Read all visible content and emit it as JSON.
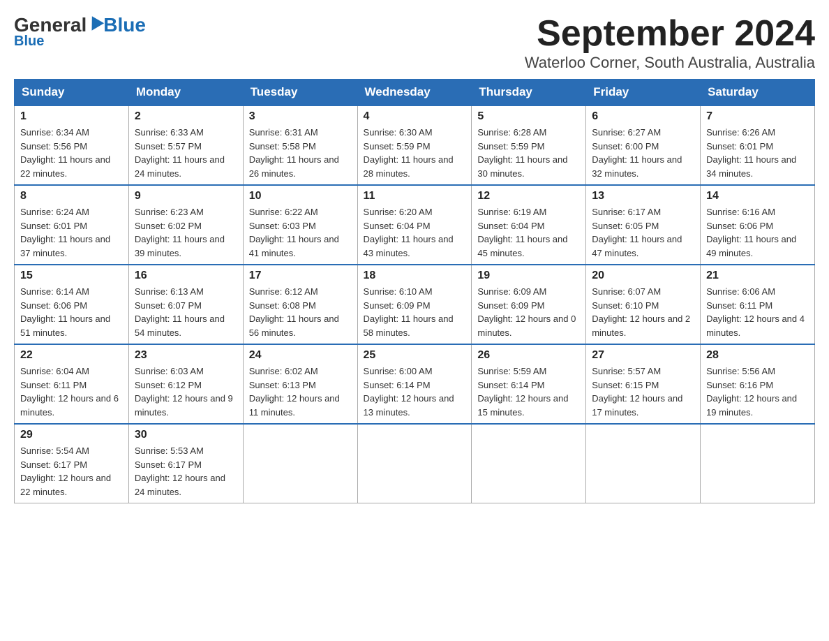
{
  "header": {
    "logo_general": "General",
    "logo_blue": "Blue",
    "month_title": "September 2024",
    "location": "Waterloo Corner, South Australia, Australia"
  },
  "weekdays": [
    "Sunday",
    "Monday",
    "Tuesday",
    "Wednesday",
    "Thursday",
    "Friday",
    "Saturday"
  ],
  "weeks": [
    [
      {
        "day": "1",
        "sunrise": "6:34 AM",
        "sunset": "5:56 PM",
        "daylight": "11 hours and 22 minutes."
      },
      {
        "day": "2",
        "sunrise": "6:33 AM",
        "sunset": "5:57 PM",
        "daylight": "11 hours and 24 minutes."
      },
      {
        "day": "3",
        "sunrise": "6:31 AM",
        "sunset": "5:58 PM",
        "daylight": "11 hours and 26 minutes."
      },
      {
        "day": "4",
        "sunrise": "6:30 AM",
        "sunset": "5:59 PM",
        "daylight": "11 hours and 28 minutes."
      },
      {
        "day": "5",
        "sunrise": "6:28 AM",
        "sunset": "5:59 PM",
        "daylight": "11 hours and 30 minutes."
      },
      {
        "day": "6",
        "sunrise": "6:27 AM",
        "sunset": "6:00 PM",
        "daylight": "11 hours and 32 minutes."
      },
      {
        "day": "7",
        "sunrise": "6:26 AM",
        "sunset": "6:01 PM",
        "daylight": "11 hours and 34 minutes."
      }
    ],
    [
      {
        "day": "8",
        "sunrise": "6:24 AM",
        "sunset": "6:01 PM",
        "daylight": "11 hours and 37 minutes."
      },
      {
        "day": "9",
        "sunrise": "6:23 AM",
        "sunset": "6:02 PM",
        "daylight": "11 hours and 39 minutes."
      },
      {
        "day": "10",
        "sunrise": "6:22 AM",
        "sunset": "6:03 PM",
        "daylight": "11 hours and 41 minutes."
      },
      {
        "day": "11",
        "sunrise": "6:20 AM",
        "sunset": "6:04 PM",
        "daylight": "11 hours and 43 minutes."
      },
      {
        "day": "12",
        "sunrise": "6:19 AM",
        "sunset": "6:04 PM",
        "daylight": "11 hours and 45 minutes."
      },
      {
        "day": "13",
        "sunrise": "6:17 AM",
        "sunset": "6:05 PM",
        "daylight": "11 hours and 47 minutes."
      },
      {
        "day": "14",
        "sunrise": "6:16 AM",
        "sunset": "6:06 PM",
        "daylight": "11 hours and 49 minutes."
      }
    ],
    [
      {
        "day": "15",
        "sunrise": "6:14 AM",
        "sunset": "6:06 PM",
        "daylight": "11 hours and 51 minutes."
      },
      {
        "day": "16",
        "sunrise": "6:13 AM",
        "sunset": "6:07 PM",
        "daylight": "11 hours and 54 minutes."
      },
      {
        "day": "17",
        "sunrise": "6:12 AM",
        "sunset": "6:08 PM",
        "daylight": "11 hours and 56 minutes."
      },
      {
        "day": "18",
        "sunrise": "6:10 AM",
        "sunset": "6:09 PM",
        "daylight": "11 hours and 58 minutes."
      },
      {
        "day": "19",
        "sunrise": "6:09 AM",
        "sunset": "6:09 PM",
        "daylight": "12 hours and 0 minutes."
      },
      {
        "day": "20",
        "sunrise": "6:07 AM",
        "sunset": "6:10 PM",
        "daylight": "12 hours and 2 minutes."
      },
      {
        "day": "21",
        "sunrise": "6:06 AM",
        "sunset": "6:11 PM",
        "daylight": "12 hours and 4 minutes."
      }
    ],
    [
      {
        "day": "22",
        "sunrise": "6:04 AM",
        "sunset": "6:11 PM",
        "daylight": "12 hours and 6 minutes."
      },
      {
        "day": "23",
        "sunrise": "6:03 AM",
        "sunset": "6:12 PM",
        "daylight": "12 hours and 9 minutes."
      },
      {
        "day": "24",
        "sunrise": "6:02 AM",
        "sunset": "6:13 PM",
        "daylight": "12 hours and 11 minutes."
      },
      {
        "day": "25",
        "sunrise": "6:00 AM",
        "sunset": "6:14 PM",
        "daylight": "12 hours and 13 minutes."
      },
      {
        "day": "26",
        "sunrise": "5:59 AM",
        "sunset": "6:14 PM",
        "daylight": "12 hours and 15 minutes."
      },
      {
        "day": "27",
        "sunrise": "5:57 AM",
        "sunset": "6:15 PM",
        "daylight": "12 hours and 17 minutes."
      },
      {
        "day": "28",
        "sunrise": "5:56 AM",
        "sunset": "6:16 PM",
        "daylight": "12 hours and 19 minutes."
      }
    ],
    [
      {
        "day": "29",
        "sunrise": "5:54 AM",
        "sunset": "6:17 PM",
        "daylight": "12 hours and 22 minutes."
      },
      {
        "day": "30",
        "sunrise": "5:53 AM",
        "sunset": "6:17 PM",
        "daylight": "12 hours and 24 minutes."
      },
      null,
      null,
      null,
      null,
      null
    ]
  ]
}
